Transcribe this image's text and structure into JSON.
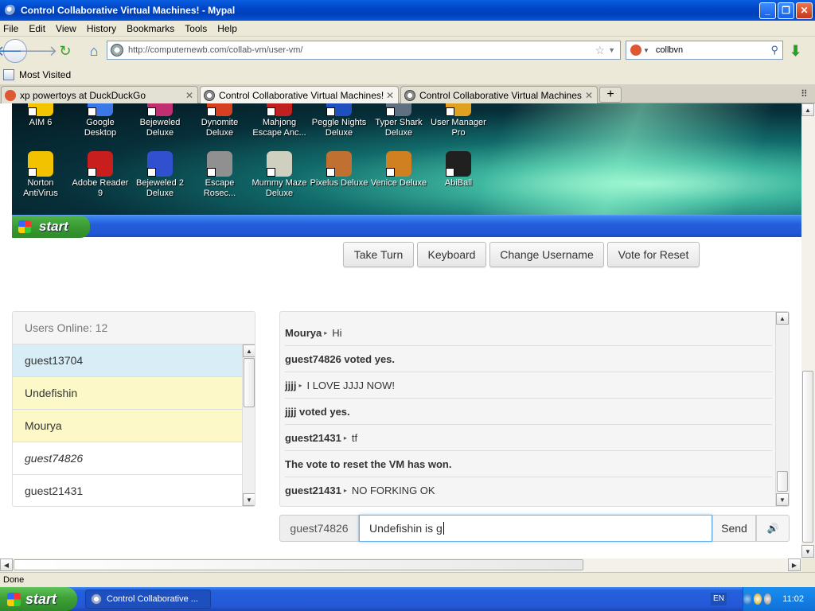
{
  "window": {
    "title": "Control Collaborative Virtual Machines! - Mypal"
  },
  "menu": [
    "File",
    "Edit",
    "View",
    "History",
    "Bookmarks",
    "Tools",
    "Help"
  ],
  "nav": {
    "url": "http://computernewb.com/collab-vm/user-vm/",
    "search_value": "collbvn"
  },
  "bookmarks": {
    "most_visited": "Most Visited"
  },
  "tabs": [
    {
      "label": "xp powertoys at DuckDuckGo"
    },
    {
      "label": "Control Collaborative Virtual Machines!"
    },
    {
      "label": "Control Collaborative Virtual Machines!"
    }
  ],
  "vm": {
    "icons_row1": [
      {
        "label": "AIM 6",
        "color": "#f5c400"
      },
      {
        "label": "Google Desktop",
        "color": "#3b78e7"
      },
      {
        "label": "Bejeweled Deluxe",
        "color": "#c03070"
      },
      {
        "label": "Dynomite Deluxe",
        "color": "#d44020"
      },
      {
        "label": "Mahjong Escape Anc...",
        "color": "#c02020"
      },
      {
        "label": "Peggle Nights Deluxe",
        "color": "#2050c0"
      },
      {
        "label": "Typer Shark Deluxe",
        "color": "#607080"
      },
      {
        "label": "User Manager Pro",
        "color": "#e0a020"
      }
    ],
    "icons_row2": [
      {
        "label": "Norton AntiVirus",
        "color": "#f2c200"
      },
      {
        "label": "Adobe Reader 9",
        "color": "#c81e1e"
      },
      {
        "label": "Bejeweled 2 Deluxe",
        "color": "#3050d0"
      },
      {
        "label": "Escape Rosec...",
        "color": "#909090"
      },
      {
        "label": "Mummy Maze Deluxe",
        "color": "#d0d0c0"
      },
      {
        "label": "Pixelus Deluxe",
        "color": "#c07030"
      },
      {
        "label": "Venice Deluxe",
        "color": "#d08020"
      },
      {
        "label": "AbiBall",
        "color": "#202020"
      }
    ],
    "start_label": "start"
  },
  "controls": {
    "take_turn": "Take Turn",
    "keyboard": "Keyboard",
    "change_username": "Change Username",
    "vote_reset": "Vote for Reset"
  },
  "users": {
    "header": "Users Online: 12",
    "list": [
      "guest13704",
      "Undefishin",
      "Mourya",
      "guest74826",
      "guest21431"
    ]
  },
  "chat": {
    "messages": [
      {
        "user": "Mourya",
        "text": "Hi"
      },
      {
        "system": "guest74826 voted yes."
      },
      {
        "user": "jjjj",
        "text": "I LOVE JJJJ NOW!"
      },
      {
        "system": "jjjj voted yes."
      },
      {
        "user": "guest21431",
        "text": "tf"
      },
      {
        "system": "The vote to reset the VM has won."
      },
      {
        "user": "guest21431",
        "text": "NO FORKING OK"
      }
    ],
    "input_user": "guest74826",
    "input_value": "Undefishin is g",
    "send_label": "Send"
  },
  "status": {
    "text": "Done"
  },
  "taskbar": {
    "start_label": "start",
    "task_label": "Control Collaborative ...",
    "lang": "EN",
    "clock": "11:02"
  }
}
